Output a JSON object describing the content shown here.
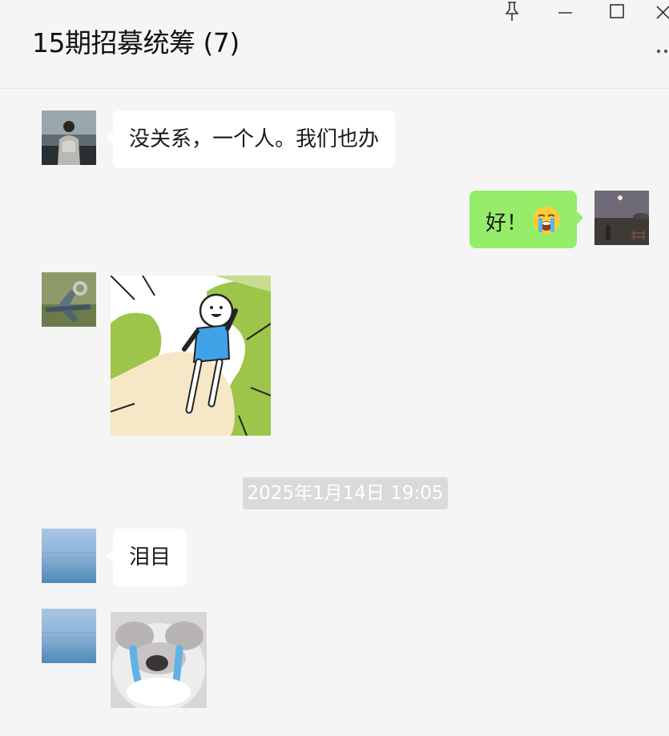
{
  "window": {
    "title": "15期招募统筹 (7)",
    "controls": [
      "pin-icon",
      "minimize-icon",
      "maximize-icon",
      "close-icon"
    ],
    "more_icon": "more-dots-icon"
  },
  "colors": {
    "background": "#f5f5f5",
    "incoming_bubble": "#ffffff",
    "outgoing_bubble": "#95ec69",
    "timestamp_bg": "#dadada"
  },
  "messages": [
    {
      "direction": "incoming",
      "type": "text",
      "text": "没关系，一个人。我们也办",
      "avatar": "person-looking-at-sea-avatar"
    },
    {
      "direction": "outgoing",
      "type": "text",
      "text": "好！",
      "emoji": "loudly-crying-face-emoji",
      "avatar": "night-field-moon-avatar"
    },
    {
      "direction": "incoming",
      "type": "sticker",
      "sticker": "running-cartoon-character-sticker",
      "avatar": "airplane-avatar"
    },
    {
      "type": "timestamp",
      "text": "2025年1月14日 19:05"
    },
    {
      "direction": "incoming",
      "type": "text",
      "text": "泪目",
      "avatar": "sea-horizon-avatar"
    },
    {
      "direction": "incoming",
      "type": "sticker",
      "sticker": "crying-cat-sticker",
      "avatar": "sea-horizon-avatar"
    }
  ]
}
